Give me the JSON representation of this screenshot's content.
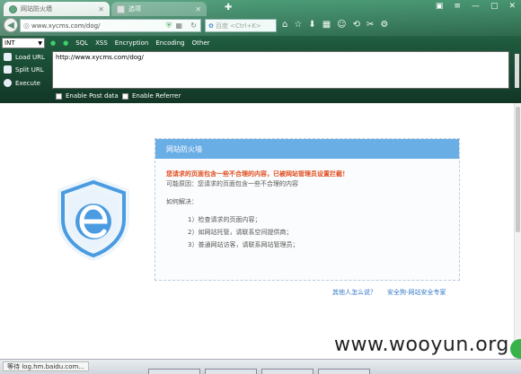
{
  "browser": {
    "tabs": [
      {
        "label": "网站防火墙",
        "active": true
      },
      {
        "label": "选项",
        "active": false
      }
    ],
    "url": "www.xycms.com/dog/",
    "search_placeholder": "百度 <Ctrl+K>",
    "colors": {
      "accent": "#2e8b57",
      "toolbar": "#1f5a3e"
    }
  },
  "hackbar": {
    "select_value": "INT",
    "menu": [
      "SQL",
      "XSS",
      "Encryption",
      "Encoding",
      "Other"
    ],
    "buttons": [
      "Load URL",
      "Split URL",
      "Execute"
    ],
    "textarea_value": "http://www.xycms.com/dog/",
    "checkboxes": [
      "Enable Post data",
      "Enable Referrer"
    ]
  },
  "page": {
    "panel_title": "网站防火墙",
    "warning": "您请求的页面包含一些不合理的内容，已被网站管理员设置拦截！",
    "reason": "可能原因：您请求的页面包含一些不合理的内容",
    "solution_label": "如何解决：",
    "steps": [
      "1）检查请求的页面内容；",
      "2）如网站托管，请联系空间提供商；",
      "3）普通网站访客，请联系网站管理员；"
    ],
    "links": [
      "其他人怎么说？",
      "安全狗-网站安全专家"
    ],
    "colors": {
      "panel_header": "#6aaee6",
      "warning": "#e04a1a",
      "link": "#3578c8",
      "logo": "#4a9be0"
    }
  },
  "watermark": "www.wooyun.org",
  "status": {
    "text": "等待 log.hm.baidu.com..."
  }
}
